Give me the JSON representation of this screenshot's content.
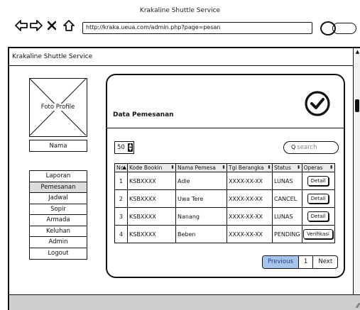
{
  "browser": {
    "window_title": "Krakaline Shuttle Service",
    "url": "http://kraka.ueua.com/admin.php?page=pesan",
    "icons": [
      "back-arrow-icon",
      "forward-arrow-icon",
      "close-x-icon",
      "home-icon",
      "search-icon"
    ]
  },
  "app": {
    "title": "Krakaline Shuttle Service"
  },
  "sidebar": {
    "photo_label": "Foto Profile",
    "name_label": "Nama",
    "menu": [
      {
        "label": "Laporan",
        "active": false
      },
      {
        "label": "Pemesanan",
        "active": true
      },
      {
        "label": "Jadwal",
        "active": false
      },
      {
        "label": "Sopir",
        "active": false
      },
      {
        "label": "Armada",
        "active": false
      },
      {
        "label": "Keluhan",
        "active": false
      },
      {
        "label": "Admin",
        "active": false
      },
      {
        "label": "Logout",
        "active": false
      }
    ]
  },
  "main": {
    "title": "Data Pemesanan",
    "status_icon": "check-circle-icon",
    "page_size": "50",
    "search_placeholder": "search",
    "table": {
      "headers": [
        "No",
        "Kode Bookin",
        "Nama Pemesa",
        "Tgl Berangka",
        "Status",
        "Operas"
      ],
      "rows": [
        {
          "no": "1",
          "kode": "KSBXXXX",
          "nama": "Adie",
          "tgl": "XXXX-XX-XX",
          "status": "LUNAS",
          "action": "Detail"
        },
        {
          "no": "2",
          "kode": "KSBXXXX",
          "nama": "Uwa Tere",
          "tgl": "XXXX-XX-XX",
          "status": "CANCEL",
          "action": "Detail"
        },
        {
          "no": "3",
          "kode": "KSBXXXX",
          "nama": "Nanang",
          "tgl": "XXXX-XX-XX",
          "status": "LUNAS",
          "action": "Detail"
        },
        {
          "no": "4",
          "kode": "KSBXXXX",
          "nama": "Beben",
          "tgl": "XXXX-XX-XX",
          "status": "PENDING",
          "action": "Verifikasi"
        }
      ]
    },
    "pagination": {
      "previous": "Previous",
      "page": "1",
      "next": "Next"
    }
  },
  "colors": {
    "active_menu_bg": "#dcdcdc",
    "previous_button_bg": "#a9c4ec",
    "status_bar_bg": "#cfcfcf"
  }
}
